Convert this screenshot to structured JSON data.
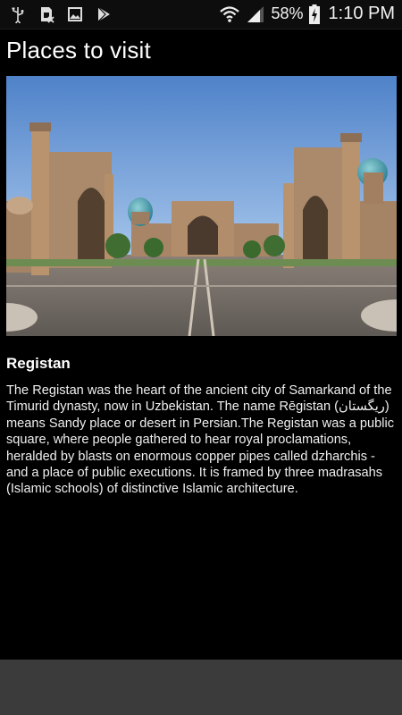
{
  "status": {
    "battery": "58%",
    "time": "1:10 PM"
  },
  "app": {
    "title": "Places to visit"
  },
  "place": {
    "name": "Registan",
    "description": "The Registan was the heart of the ancient city of Samarkand of the Timurid dynasty, now in Uzbekistan. The name Rēgistan (ریگستان) means Sandy place or desert in Persian.The Registan was a public square, where people gathered to hear royal proclamations, heralded by blasts on enormous copper pipes called dzharchis - and a place of public executions. It is framed by three madrasahs (Islamic schools) of distinctive Islamic architecture."
  },
  "icons": {
    "status_left": [
      "usb-icon",
      "sim-error-icon",
      "gallery-icon",
      "play-store-icon"
    ],
    "status_right": [
      "wifi-icon",
      "signal-icon",
      "battery-charging-icon"
    ]
  }
}
